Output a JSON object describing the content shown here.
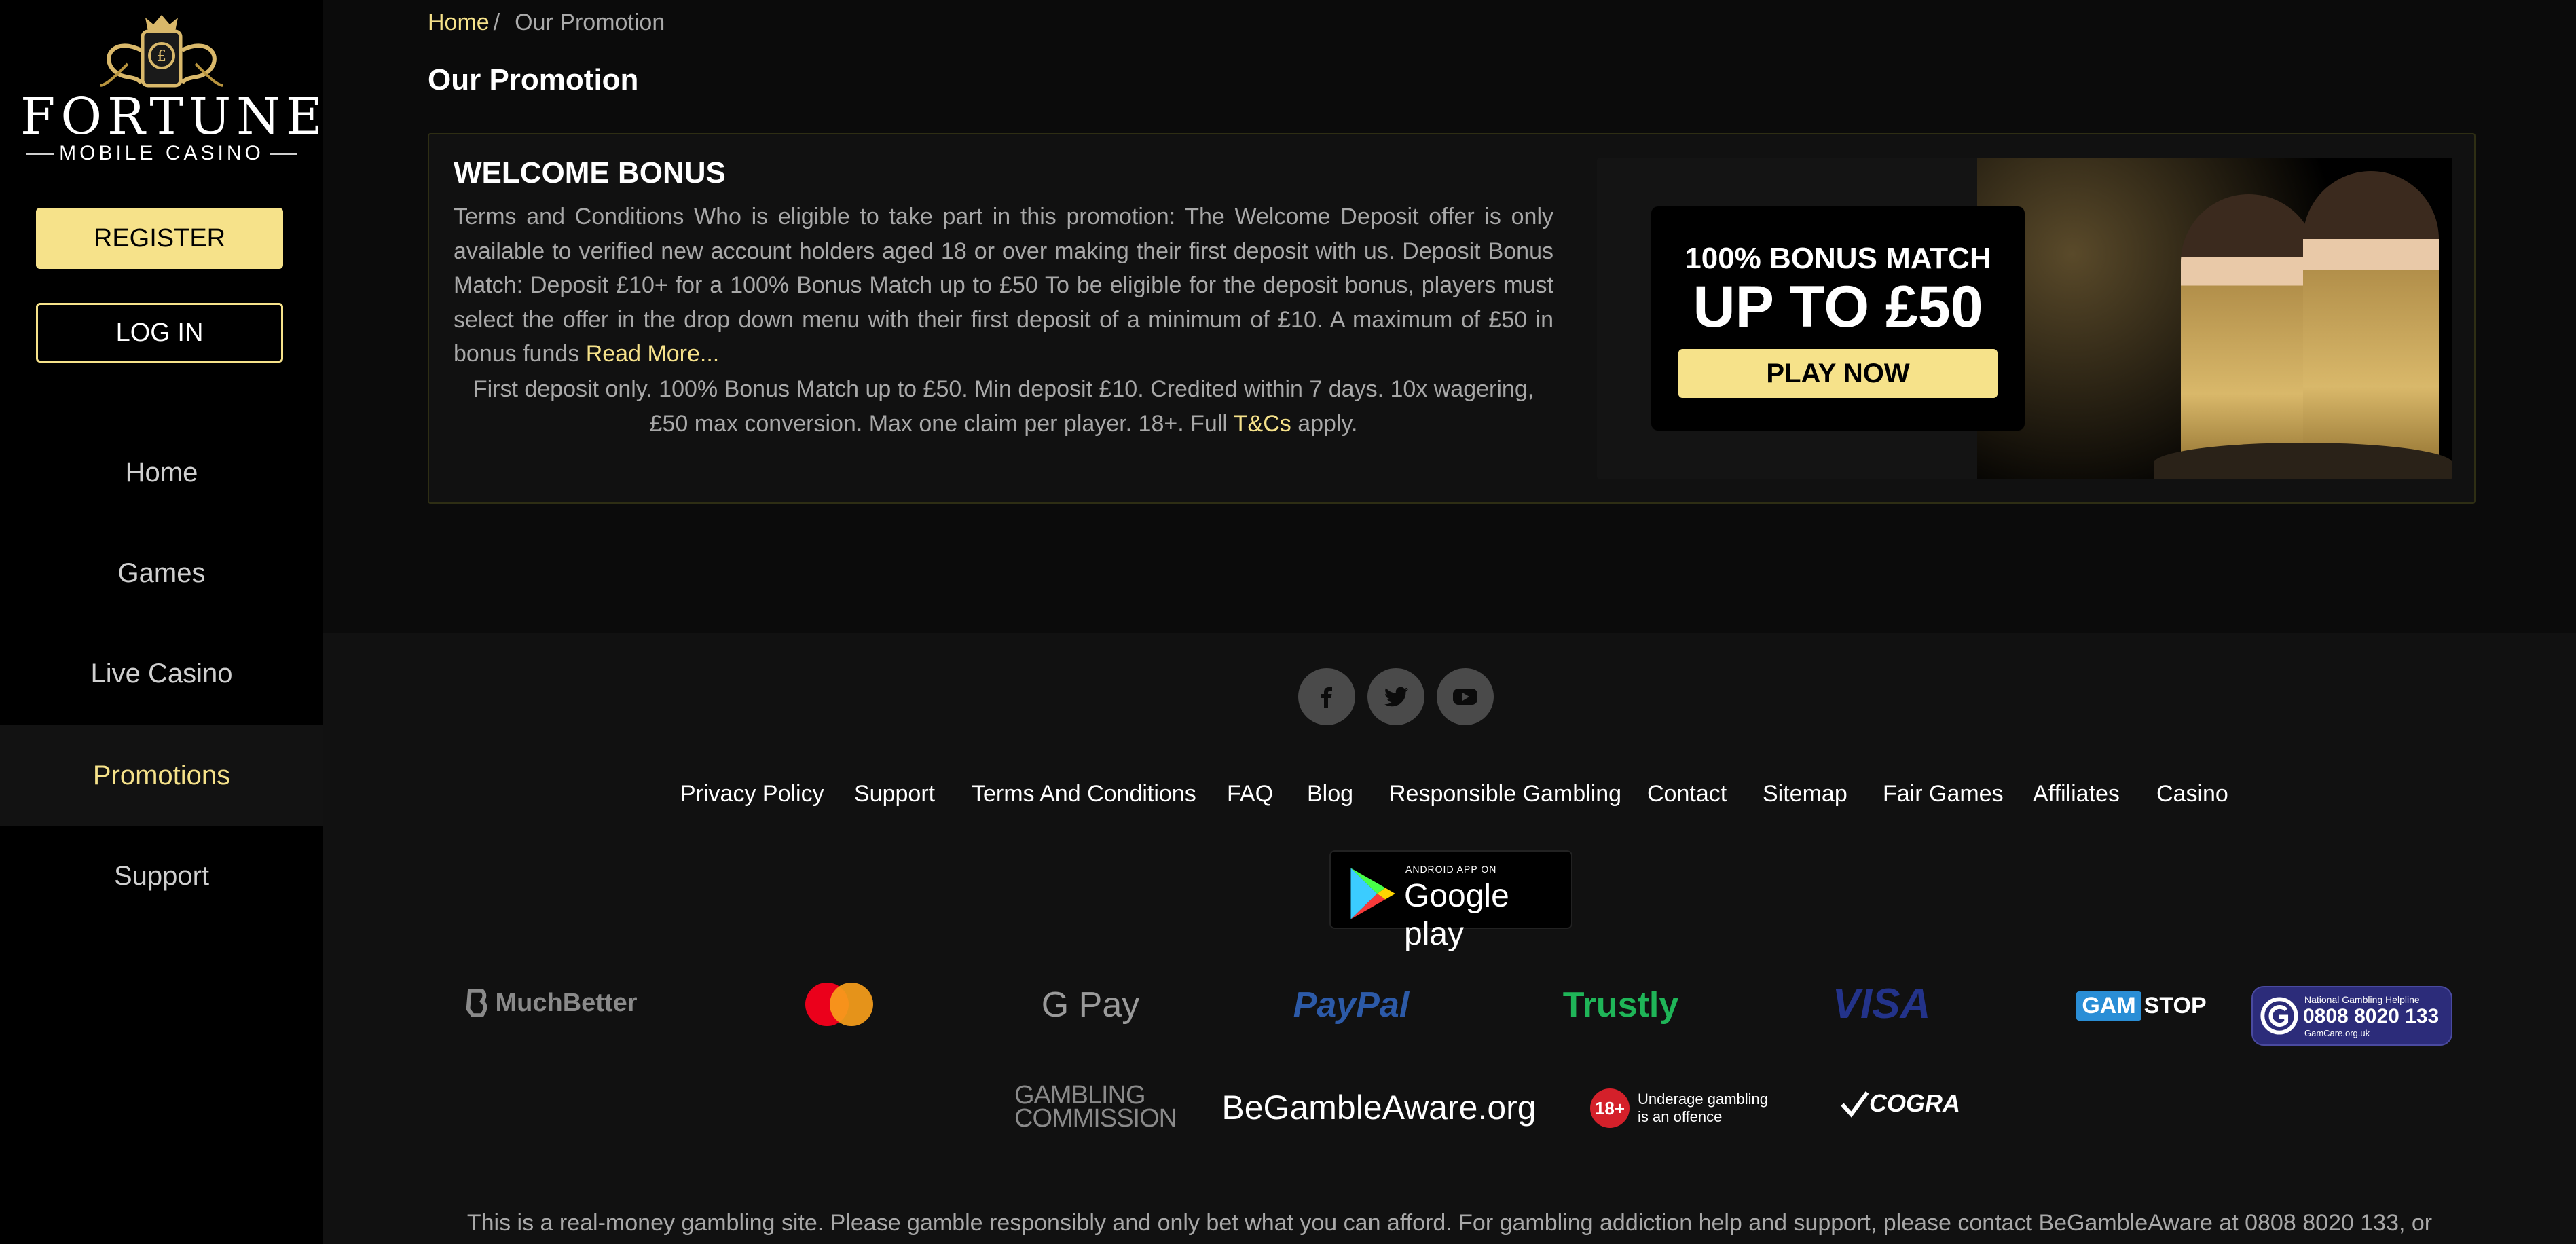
{
  "colors": {
    "accent": "#f6e28a",
    "background": "#0b0b0b",
    "sidebar": "#000000",
    "footer": "#111111"
  },
  "sidebar": {
    "logo_brand": "FORTUNE",
    "logo_sub": "MOBILE CASINO",
    "register_label": "REGISTER",
    "login_label": "LOG IN",
    "nav": [
      {
        "label": "Home",
        "active": false
      },
      {
        "label": "Games",
        "active": false
      },
      {
        "label": "Live Casino",
        "active": false
      },
      {
        "label": "Promotions",
        "active": true
      },
      {
        "label": "Support",
        "active": false
      }
    ]
  },
  "breadcrumb": {
    "home": "Home",
    "separator": "/",
    "current": "Our Promotion"
  },
  "page_title": "Our Promotion",
  "promo": {
    "title": "WELCOME BONUS",
    "terms": "Terms and Conditions Who is eligible to take part in this promotion: The Welcome Deposit offer is only available to verified new account holders aged 18 or over making their first deposit with us. Deposit Bonus Match: Deposit £10+ for a 100% Bonus Match up to £50 To be eligible for the deposit bonus, players must select the offer in the drop down menu with their first deposit of a minimum of £10. A maximum of £50 in bonus funds",
    "read_more": "Read More...",
    "summary": "First deposit only. 100% Bonus Match up to £50. Min deposit £10. Credited within 7 days. 10x wagering, £50 max conversion. Max one claim per player. 18+. Full",
    "tc_link": "T&Cs",
    "summary_end": "apply.",
    "banner": {
      "line1": "100% BONUS MATCH",
      "line2": "UP TO £50",
      "cta": "PLAY NOW"
    }
  },
  "footer": {
    "social": [
      "facebook-icon",
      "twitter-icon",
      "youtube-icon"
    ],
    "links": [
      "Privacy Policy",
      "Support",
      "Terms And Conditions",
      "FAQ",
      "Blog",
      "Responsible Gambling",
      "Contact",
      "Sitemap",
      "Fair Games",
      "Affiliates",
      "Casino"
    ],
    "google_play": {
      "small": "ANDROID APP ON",
      "big": "Google play"
    },
    "payments": {
      "muchbetter": "MuchBetter",
      "gpay": "G Pay",
      "paypal": "PayPal",
      "trustly": "Trustly",
      "visa": "VISA",
      "gamstop_gam": "GAM",
      "gamstop_stop": "STOP",
      "helpline_title": "National Gambling Helpline",
      "helpline_number": "0808 8020 133",
      "helpline_site": "GamCare.org.uk"
    },
    "trust": {
      "gambling_commission_1": "GAMBLING",
      "gambling_commission_2": "COMMISSION",
      "begambleaware": "BeGambleAware.org",
      "age_badge": "18+",
      "age_text_1": "Underage gambling",
      "age_text_2": "is an offence",
      "ecogra": "COGRA"
    },
    "disclaimer": "This is a real-money gambling site. Please gamble responsibly and only bet what you can afford. For gambling addiction help and support, please contact BeGambleAware at 0808 8020 133, or"
  }
}
